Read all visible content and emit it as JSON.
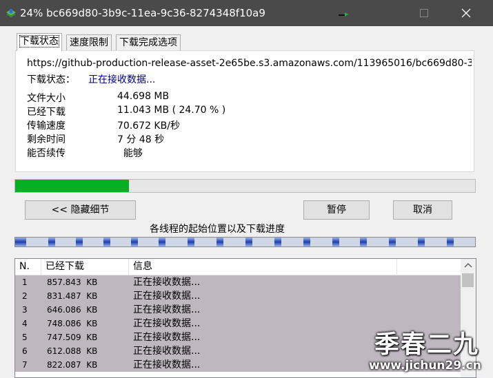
{
  "window": {
    "title": "24% bc669d80-3b9c-11ea-9c36-8274348f10a9"
  },
  "tabs": [
    {
      "label": "下载状态",
      "active": true
    },
    {
      "label": "速度限制",
      "active": false
    },
    {
      "label": "下载完成选项",
      "active": false
    }
  ],
  "status": {
    "url": "https://github-production-release-asset-2e65be.s3.amazonaws.com/113965016/bc669d80-3b9c-",
    "state_label": "下载状态：",
    "state_value": "正在接收数据...",
    "rows": [
      {
        "label": "文件大小",
        "value": "44.698  MB"
      },
      {
        "label": "已经下载",
        "value": "11.043  MB  ( 24.70 % )"
      },
      {
        "label": "传输速度",
        "value": "70.672  KB/秒"
      },
      {
        "label": "剩余时间",
        "value": "7 分 48 秒"
      },
      {
        "label": "能否续传",
        "value": "  能够"
      }
    ]
  },
  "progress": {
    "percent": 24.7
  },
  "buttons": {
    "hide_details": "<< 隐藏细节",
    "pause": "暂停",
    "cancel": "取消"
  },
  "threads": {
    "label": "各线程的起始位置以及下载进度"
  },
  "connections": {
    "columns": [
      "N.",
      "已经下载",
      "信息"
    ],
    "rows": [
      {
        "n": "1",
        "downloaded": "857.843  KB",
        "info": "正在接收数据..."
      },
      {
        "n": "2",
        "downloaded": "831.487  KB",
        "info": "正在接收数据..."
      },
      {
        "n": "3",
        "downloaded": "646.086  KB",
        "info": "正在接收数据..."
      },
      {
        "n": "4",
        "downloaded": "748.086  KB",
        "info": "正在接收数据..."
      },
      {
        "n": "5",
        "downloaded": "747.509  KB",
        "info": "正在接收数据..."
      },
      {
        "n": "6",
        "downloaded": "612.088  KB",
        "info": "正在接收数据..."
      },
      {
        "n": "7",
        "downloaded": "822.087  KB",
        "info": "正在接收数据..."
      }
    ]
  },
  "watermark": {
    "main": "季春二九",
    "url": "www.jichun29.cn"
  },
  "colors": {
    "titlebar": "#4a4a4a",
    "progress_fill": "#06b025",
    "row_highlight": "#bfb7bf",
    "status_value": "#000080"
  }
}
